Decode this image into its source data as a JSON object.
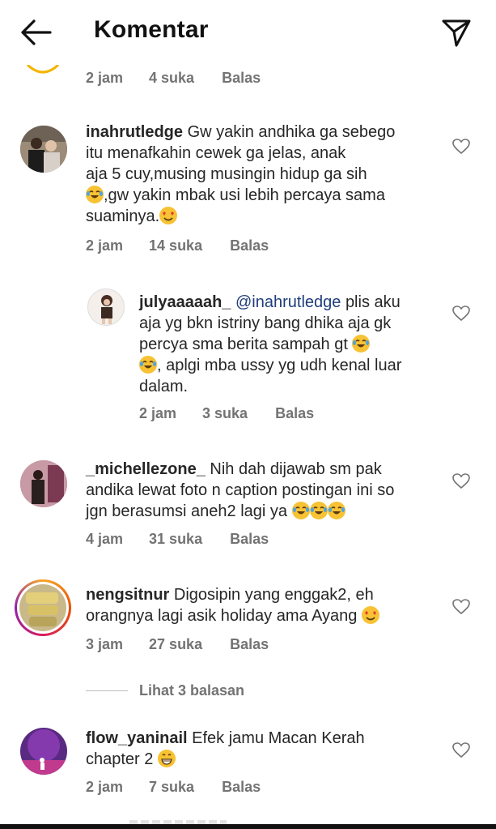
{
  "header": {
    "title": "Komentar",
    "back_icon": "arrow-left-icon",
    "send_icon": "paper-plane-icon"
  },
  "top_meta": {
    "time": "2 jam",
    "likes": "4 suka",
    "reply": "Balas"
  },
  "comments": [
    {
      "username": "inahrutledge",
      "text_lines": [
        "Gw yakin andhika ga sebego",
        "itu menafkahin cewek ga jelas, anak",
        "aja 5 cuy,musing musingin hidup ga sih",
        ",gw yakin mbak usi lebih percaya sama",
        "suaminya."
      ],
      "time": "2 jam",
      "likes": "14 suka",
      "reply": "Balas"
    },
    {
      "username": "julyaaaaah_",
      "mention": "@inahrutledge",
      "text_lines": [
        "plis aku",
        "aja yg bkn istriny bang dhika aja gk",
        "percya sma berita sampah gt",
        ", aplgi mba ussy yg udh kenal luar",
        "dalam."
      ],
      "time": "2 jam",
      "likes": "3 suka",
      "reply": "Balas"
    },
    {
      "username": "_michellezone_",
      "text_lines": [
        "Nih dah dijawab sm pak",
        "andika lewat foto n caption postingan ini so",
        "jgn berasumsi aneh2 lagi ya"
      ],
      "time": "4 jam",
      "likes": "31 suka",
      "reply": "Balas"
    },
    {
      "username": "nengsitnur",
      "text_lines": [
        "Digosipin yang enggak2, eh",
        "orangnya lagi asik holiday ama Ayang"
      ],
      "time": "3 jam",
      "likes": "27 suka",
      "reply": "Balas",
      "view_replies": "Lihat 3 balasan"
    },
    {
      "username": "flow_yaninail",
      "text_lines": [
        "Efek jamu Macan Kerah",
        "chapter 2"
      ],
      "time": "2 jam",
      "likes": "7 suka",
      "reply": "Balas"
    }
  ],
  "colors": {
    "text": "#262626",
    "meta": "#737373",
    "mention": "#1f3d7a",
    "story_ring_start": "#f9a825",
    "story_ring_end": "#d81b60"
  }
}
